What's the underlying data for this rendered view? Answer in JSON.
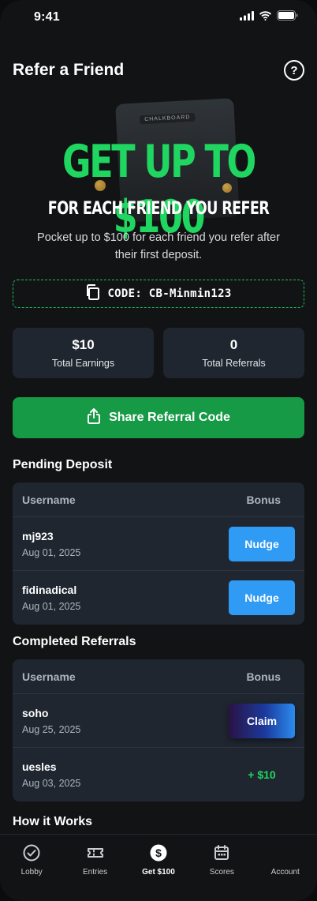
{
  "status_bar": {
    "time": "9:41"
  },
  "header": {
    "title": "Refer a Friend",
    "help_icon": "question-circle-icon"
  },
  "hero": {
    "art_brand": "CHALKBOARD",
    "headline": "GET UP TO $100",
    "subheadline": "FOR EACH FRIEND YOU REFER",
    "description": "Pocket up to $100 for each friend you refer after their first deposit."
  },
  "referral_code": {
    "label": "CODE: CB-Minmin123",
    "icon": "copy-icon"
  },
  "stats": [
    {
      "value": "$10",
      "label": "Total Earnings"
    },
    {
      "value": "0",
      "label": "Total Referrals"
    }
  ],
  "share_button": {
    "label": "Share Referral Code",
    "icon": "share-icon"
  },
  "pending": {
    "title": "Pending Deposit",
    "columns": [
      "Username",
      "Bonus"
    ],
    "rows": [
      {
        "username": "mj923",
        "date": "Aug 01, 2025",
        "action": "Nudge"
      },
      {
        "username": "fidinadical",
        "date": "Aug 01, 2025",
        "action": "Nudge"
      }
    ]
  },
  "completed": {
    "title": "Completed Referrals",
    "columns": [
      "Username",
      "Bonus"
    ],
    "rows": [
      {
        "username": "soho",
        "date": "Aug 25, 2025",
        "action": "Claim"
      },
      {
        "username": "uesles",
        "date": "Aug 03, 2025",
        "bonus": "+ $10"
      }
    ]
  },
  "how_it_works": {
    "title": "How it Works"
  },
  "tabs": [
    {
      "label": "Lobby",
      "icon": "check-circle-icon"
    },
    {
      "label": "Entries",
      "icon": "ticket-icon"
    },
    {
      "label": "Get $100",
      "icon": "dollar-circle-icon",
      "active": true
    },
    {
      "label": "Scores",
      "icon": "calendar-icon"
    },
    {
      "label": "Account",
      "icon": "user-icon"
    }
  ],
  "colors": {
    "accent_green": "#1fd760",
    "share_green": "#169a45",
    "nudge_blue": "#2f9bf5",
    "card_bg": "#1f2630",
    "page_bg": "#121314"
  }
}
